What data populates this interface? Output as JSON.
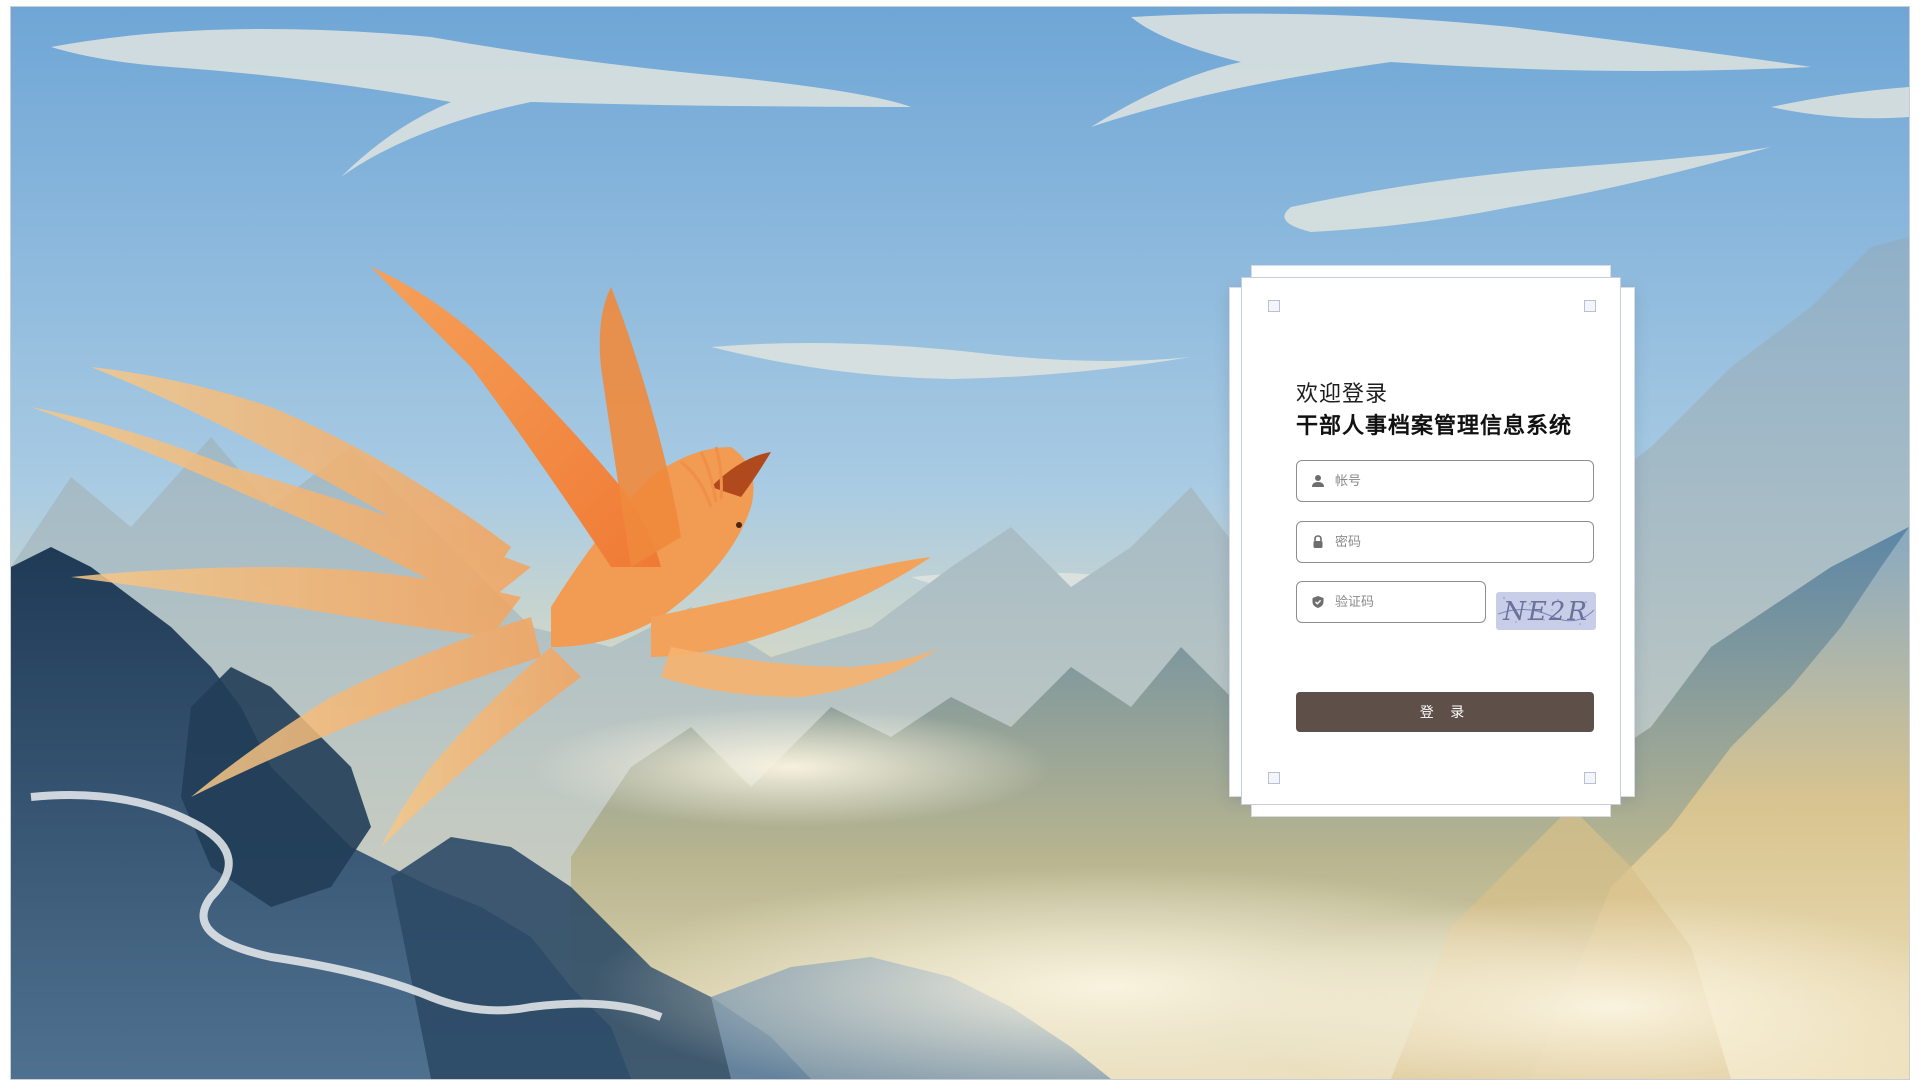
{
  "welcome": "欢迎登录",
  "system_name": "干部人事档案管理信息系统",
  "fields": {
    "account_placeholder": "帐号",
    "password_placeholder": "密码",
    "captcha_placeholder": "验证码"
  },
  "captcha_text": "NE2R",
  "login_label": "登 录",
  "icons": {
    "account": "user-icon",
    "password": "lock-icon",
    "captcha": "shield-icon"
  },
  "colors": {
    "login_button": "#5e5048",
    "sky_top": "#74a9d6",
    "phoenix": "#f08a3c"
  }
}
